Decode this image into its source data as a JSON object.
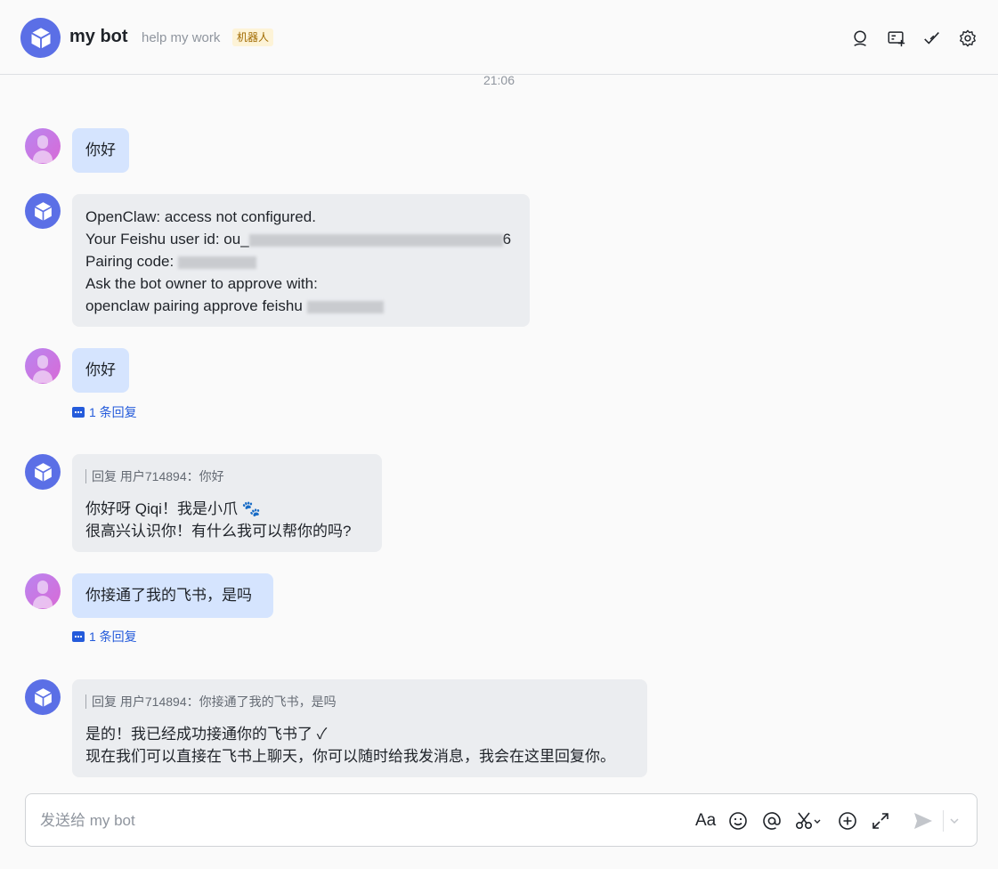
{
  "header": {
    "title": "my bot",
    "subtitle": "help my work",
    "badge": "机器人",
    "icons": [
      "search-icon",
      "add-chat-icon",
      "approve-icon",
      "settings-icon"
    ]
  },
  "chat": {
    "timestamp": "21:06",
    "messages": [
      {
        "sender": "user",
        "lines": [
          "你好"
        ]
      },
      {
        "sender": "bot",
        "lines": [
          "OpenClaw: access not configured.",
          "Your Feishu user id: ou_",
          "Pairing code: ",
          "Ask the bot owner to approve with:",
          "openclaw pairing approve feishu "
        ],
        "user_id_suffix": "6"
      },
      {
        "sender": "user",
        "lines": [
          "你好"
        ],
        "reply_count": "1 条回复"
      },
      {
        "sender": "bot",
        "quote": "回复 用户714894：你好",
        "lines": [
          "你好呀 Qiqi！我是小爪 🐾",
          "很高兴认识你！有什么我可以帮你的吗?"
        ]
      },
      {
        "sender": "user",
        "lines": [
          "你接通了我的飞书，是吗"
        ],
        "reply_count": "1 条回复"
      },
      {
        "sender": "bot",
        "quote": "回复 用户714894：你接通了我的飞书，是吗",
        "lines": [
          "是的！我已经成功接通你的飞书了 ✓",
          "现在我们可以直接在飞书上聊天，你可以随时给我发消息，我会在这里回复你。"
        ]
      }
    ]
  },
  "composer": {
    "placeholder": "发送给 my bot",
    "icons": [
      "text-format-icon",
      "emoji-icon",
      "mention-icon",
      "scissors-icon",
      "add-icon",
      "expand-icon",
      "send-icon",
      "send-options-icon"
    ],
    "format_label": "Aa"
  },
  "colors": {
    "accent": "#245bdb",
    "user_bubble": "#d5e4fe",
    "bot_bubble": "#ebedf0",
    "bot_avatar": "#5b6fe6"
  }
}
